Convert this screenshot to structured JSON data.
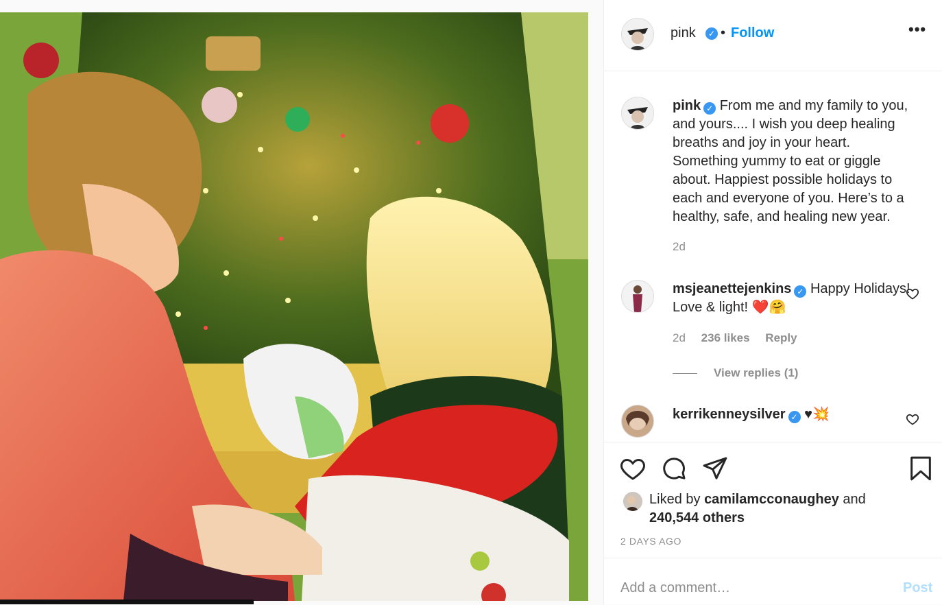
{
  "post": {
    "author": "pink",
    "follow_label": "Follow",
    "dot": "•",
    "more_label": "•••"
  },
  "caption": {
    "author": "pink",
    "text": "From me and my family to you, and yours.... I wish you deep healing breaths and joy in your heart. Something yummy to eat or giggle about. Happiest possible holidays to each and everyone of you. Here’s to a healthy, safe, and healing new year.",
    "age": "2d"
  },
  "comments": [
    {
      "author": "msjeanettejenkins",
      "text": "Happy Holidays! Love & light! ❤️🤗",
      "age": "2d",
      "likes": "236 likes",
      "reply_label": "Reply",
      "view_replies": "View replies (1)"
    },
    {
      "author": "kerrikenneysilver",
      "text": "♥💥"
    }
  ],
  "liked_by": {
    "prefix": "Liked by",
    "user": "camilamcconaughey",
    "and": "and",
    "others": "240,544 others"
  },
  "date_label": "2 DAYS AGO",
  "add_comment": {
    "placeholder": "Add a comment…",
    "post_label": "Post"
  },
  "icons": {
    "verified": "verified-badge-icon",
    "like": "heart-icon",
    "comment": "comment-bubble-icon",
    "share": "paper-plane-icon",
    "save": "bookmark-icon"
  },
  "colors": {
    "link_blue": "#0095f6",
    "verified_blue": "#3897f0",
    "muted_gray": "#8e8e8e",
    "post_disabled": "#b2dffc"
  }
}
